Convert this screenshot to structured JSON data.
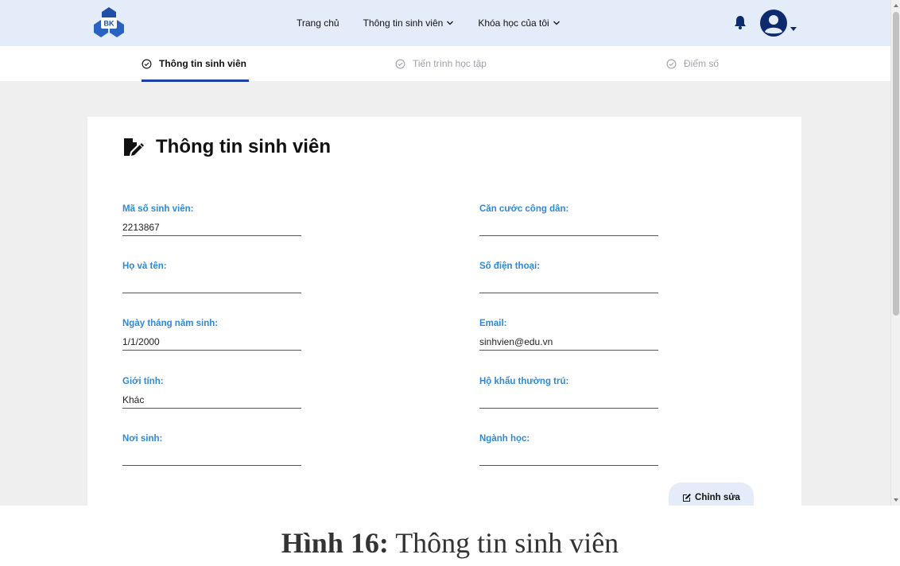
{
  "nav": {
    "logo_text": "BK",
    "links": [
      {
        "label": "Trang chủ",
        "has_dropdown": false
      },
      {
        "label": "Thông tin sinh viên",
        "has_dropdown": true
      },
      {
        "label": "Khóa học của tôi",
        "has_dropdown": true
      }
    ],
    "icons": [
      "bell-icon",
      "user-avatar-icon"
    ]
  },
  "tabs": [
    {
      "label": "Thông tin sinh viên",
      "active": true
    },
    {
      "label": "Tiến trình học tập",
      "active": false
    },
    {
      "label": "Điểm số",
      "active": false
    }
  ],
  "card": {
    "title": "Thông tin sinh viên",
    "fields_left": [
      {
        "label": "Mã số sinh viên:",
        "value": "2213867"
      },
      {
        "label": "Họ và tên:",
        "value": ""
      },
      {
        "label": "Ngày tháng năm sinh:",
        "value": "1/1/2000"
      },
      {
        "label": "Giới tính:",
        "value": "Khác"
      },
      {
        "label": "Nơi sinh:",
        "value": ""
      }
    ],
    "fields_right": [
      {
        "label": "Căn cước công dân:",
        "value": ""
      },
      {
        "label": "Số điện thoại:",
        "value": ""
      },
      {
        "label": "Email:",
        "value": "sinhvien@edu.vn"
      },
      {
        "label": "Hộ khẩu thường trú:",
        "value": ""
      },
      {
        "label": "Ngành học:",
        "value": ""
      }
    ],
    "edit_button": "Chỉnh sửa"
  },
  "caption": {
    "prefix": "Hình 16:",
    "text": " Thông tin sinh viên"
  },
  "colors": {
    "nav_bg": "#e3ecf8",
    "accent_blue": "#1d3fa6",
    "label_blue": "#2f88d8",
    "page_bg": "#efefef"
  }
}
